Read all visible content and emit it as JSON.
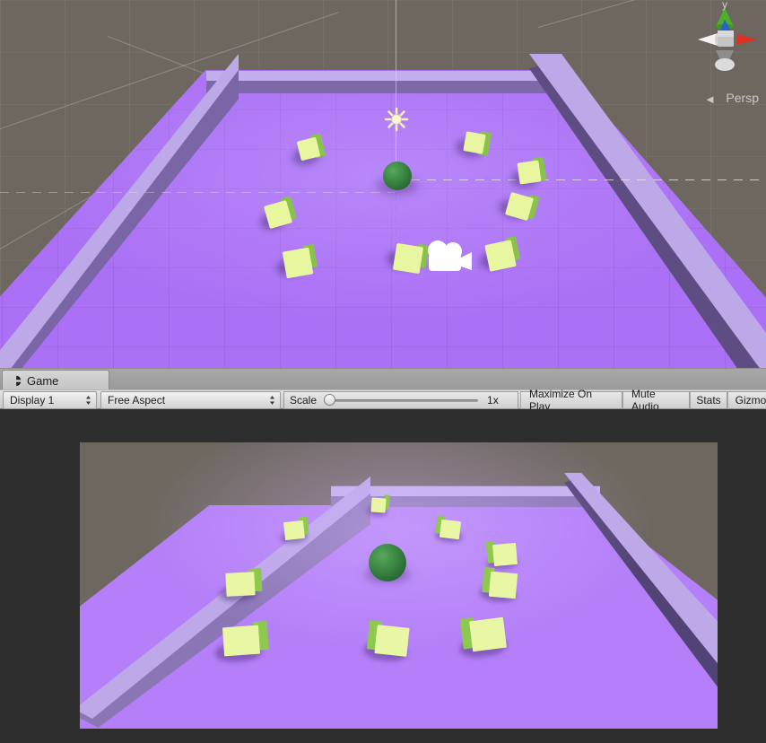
{
  "window": {
    "app": "Unity Editor",
    "scene_view": {
      "name": "Scene View",
      "background_color": "#6d6760",
      "floor_color": "#aa70f5",
      "wall_top_color": "#bda8e8",
      "wall_face_color": "#7d68a8",
      "cube_top_color": "#e8f6a0",
      "cube_side_color": "#88c24a",
      "sphere_color": "#3c8a45",
      "gizmo": {
        "name": "scene-orientation-gizmo",
        "axis_label_y": "y",
        "projection_label": "Persp",
        "projection_arrow": "◄",
        "axis_colors": {
          "x": "#e03020",
          "y": "#4caf2e",
          "z": "#2a5fd0",
          "neutral": "#d8d8d8"
        }
      },
      "objects": {
        "light_gizmo": "light-gizmo-icon",
        "camera_gizmo": "camera-gizmo-icon",
        "sphere": "sphere-object",
        "cube_count": 8
      }
    }
  },
  "tabbar": {
    "tabs": [
      {
        "id": "game",
        "label": "Game",
        "icon": "game-view-icon",
        "active": true
      }
    ]
  },
  "toolbar": {
    "display": {
      "label": "Display 1",
      "icon": "chevron-updown-icon",
      "options": [
        "Display 1"
      ]
    },
    "aspect": {
      "label": "Free Aspect",
      "icon": "chevron-updown-icon",
      "options": [
        "Free Aspect"
      ]
    },
    "scale": {
      "label": "Scale",
      "value": "1x",
      "slider_position_percent": 0
    },
    "buttons": [
      {
        "id": "maximize-on-play",
        "label": "Maximize On Play"
      },
      {
        "id": "mute-audio",
        "label": "Mute Audio"
      },
      {
        "id": "stats",
        "label": "Stats"
      },
      {
        "id": "gizmos",
        "label": "Gizmos"
      }
    ]
  },
  "game_view": {
    "name": "Game View",
    "panel_background": "#2e2e2e",
    "render_background": "#6d6760",
    "floor_color": "#b47ff8",
    "wall_top_color": "#bda8e8",
    "wall_face_color": "#8a76b4",
    "cube_top_color": "#e9f7a4",
    "cube_side_color": "#8ec84e",
    "sphere_color": "#3c8a45",
    "cube_count": 8
  }
}
